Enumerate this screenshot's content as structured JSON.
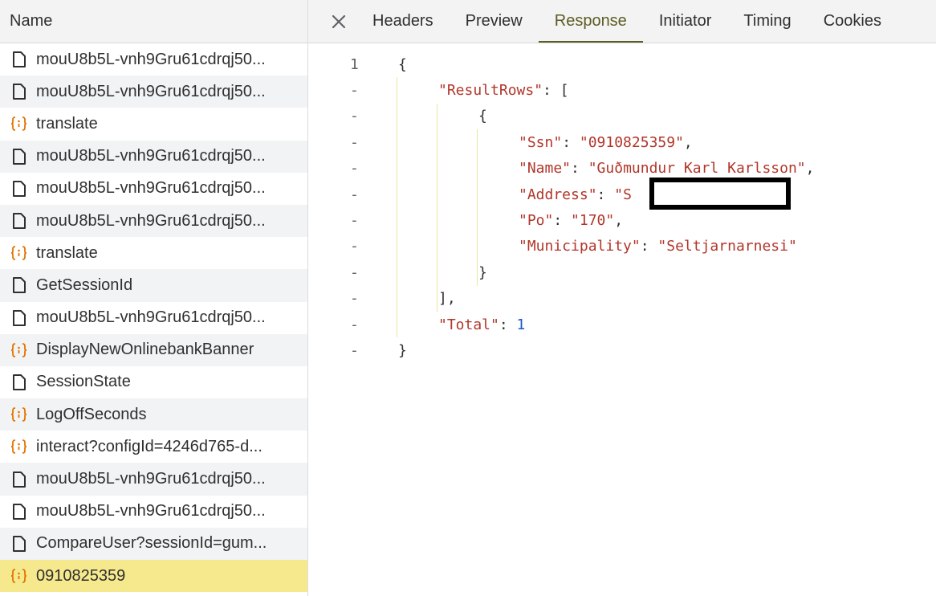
{
  "request_list": {
    "header": "Name",
    "rows": [
      {
        "label": "mouU8b5L-vnh9Gru61cdrqj50...",
        "icon": "document-icon"
      },
      {
        "label": "mouU8b5L-vnh9Gru61cdrqj50...",
        "icon": "document-icon"
      },
      {
        "label": "translate",
        "icon": "json-icon"
      },
      {
        "label": "mouU8b5L-vnh9Gru61cdrqj50...",
        "icon": "document-icon"
      },
      {
        "label": "mouU8b5L-vnh9Gru61cdrqj50...",
        "icon": "document-icon"
      },
      {
        "label": "mouU8b5L-vnh9Gru61cdrqj50...",
        "icon": "document-icon"
      },
      {
        "label": "translate",
        "icon": "json-icon"
      },
      {
        "label": "GetSessionId",
        "icon": "document-icon"
      },
      {
        "label": "mouU8b5L-vnh9Gru61cdrqj50...",
        "icon": "document-icon"
      },
      {
        "label": "DisplayNewOnlinebankBanner",
        "icon": "json-icon"
      },
      {
        "label": "SessionState",
        "icon": "document-icon"
      },
      {
        "label": "LogOffSeconds",
        "icon": "json-icon"
      },
      {
        "label": "interact?configId=4246d765-d...",
        "icon": "json-icon"
      },
      {
        "label": "mouU8b5L-vnh9Gru61cdrqj50...",
        "icon": "document-icon"
      },
      {
        "label": "mouU8b5L-vnh9Gru61cdrqj50...",
        "icon": "document-icon"
      },
      {
        "label": "CompareUser?sessionId=gum...",
        "icon": "document-icon"
      },
      {
        "label": "0910825359",
        "icon": "json-icon",
        "selected": true
      }
    ]
  },
  "tabs": {
    "close_icon": "close-icon",
    "items": [
      "Headers",
      "Preview",
      "Response",
      "Initiator",
      "Timing",
      "Cookies"
    ],
    "active": "Response"
  },
  "response": {
    "first_line_number": "1",
    "fold_marker": "-",
    "lines": [
      {
        "indent": 0,
        "tokens": [
          {
            "t": "{",
            "c": "punc"
          }
        ]
      },
      {
        "indent": 1,
        "tokens": [
          {
            "t": "\"ResultRows\"",
            "c": "key"
          },
          {
            "t": ": [",
            "c": "punc"
          }
        ]
      },
      {
        "indent": 2,
        "tokens": [
          {
            "t": "{",
            "c": "punc"
          }
        ]
      },
      {
        "indent": 3,
        "tokens": [
          {
            "t": "\"Ssn\"",
            "c": "key"
          },
          {
            "t": ": ",
            "c": "punc"
          },
          {
            "t": "\"0910825359\"",
            "c": "str"
          },
          {
            "t": ",",
            "c": "punc"
          }
        ]
      },
      {
        "indent": 3,
        "tokens": [
          {
            "t": "\"Name\"",
            "c": "key"
          },
          {
            "t": ": ",
            "c": "punc"
          },
          {
            "t": "\"Guðmundur Karl Karlsson\"",
            "c": "str"
          },
          {
            "t": ",",
            "c": "punc"
          }
        ]
      },
      {
        "indent": 3,
        "tokens": [
          {
            "t": "\"Address\"",
            "c": "key"
          },
          {
            "t": ": ",
            "c": "punc"
          },
          {
            "t": "\"S",
            "c": "str"
          }
        ]
      },
      {
        "indent": 3,
        "tokens": [
          {
            "t": "\"Po\"",
            "c": "key"
          },
          {
            "t": ": ",
            "c": "punc"
          },
          {
            "t": "\"170\"",
            "c": "str"
          },
          {
            "t": ",",
            "c": "punc"
          }
        ]
      },
      {
        "indent": 3,
        "tokens": [
          {
            "t": "\"Municipality\"",
            "c": "key"
          },
          {
            "t": ": ",
            "c": "punc"
          },
          {
            "t": "\"Seltjarnarnesi\"",
            "c": "str"
          }
        ]
      },
      {
        "indent": 2,
        "tokens": [
          {
            "t": "}",
            "c": "punc"
          }
        ]
      },
      {
        "indent": 1,
        "tokens": [
          {
            "t": "],",
            "c": "punc"
          }
        ]
      },
      {
        "indent": 1,
        "tokens": [
          {
            "t": "\"Total\"",
            "c": "key"
          },
          {
            "t": ": ",
            "c": "punc"
          },
          {
            "t": "1",
            "c": "num"
          }
        ]
      },
      {
        "indent": 0,
        "tokens": [
          {
            "t": "}",
            "c": "punc"
          }
        ]
      }
    ]
  },
  "colors": {
    "key": "#b1362a",
    "string": "#b1362a",
    "number": "#1a56c8",
    "active_tab": "#5d5b22",
    "selected_row": "#f6e98d",
    "json_icon": "#e37400"
  }
}
